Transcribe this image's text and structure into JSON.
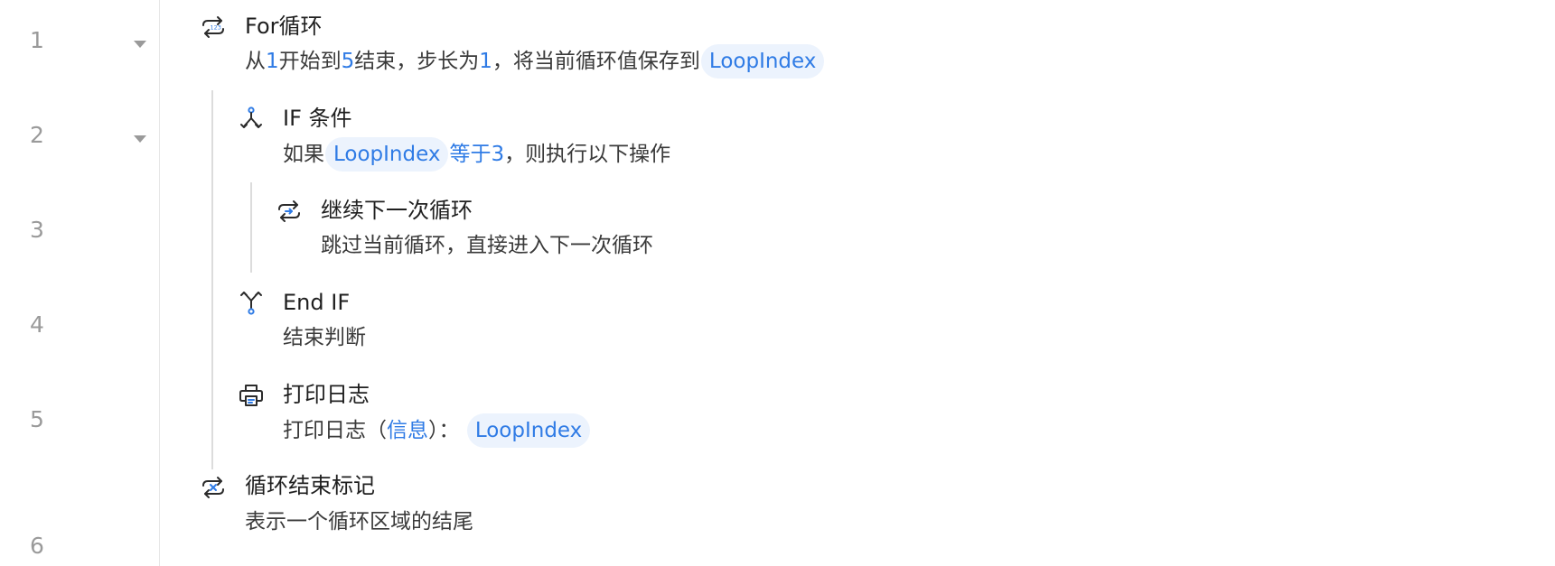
{
  "line_numbers": [
    "1",
    "2",
    "3",
    "4",
    "5",
    "6"
  ],
  "steps": {
    "for_loop": {
      "title": "For循环",
      "desc_from": "从",
      "start": "1",
      "desc_begin_to": "开始到",
      "end": "5",
      "desc_end_step": "结束，步长为",
      "step": "1",
      "desc_save_to": "，将当前循环值保存到",
      "var": "LoopIndex"
    },
    "if_condition": {
      "title": "IF 条件",
      "desc_if": "如果",
      "var": "LoopIndex",
      "op": "等于3",
      "desc_then": "，则执行以下操作"
    },
    "continue_loop": {
      "title": "继续下一次循环",
      "desc": "跳过当前循环，直接进入下一次循环"
    },
    "end_if": {
      "title": "End IF",
      "desc": "结束判断"
    },
    "print_log": {
      "title": "打印日志",
      "desc_prefix": "打印日志（",
      "level": "信息",
      "desc_suffix": "）：",
      "var": "LoopIndex"
    },
    "loop_end": {
      "title": "循环结束标记",
      "desc": "表示一个循环区域的结尾"
    }
  },
  "colors": {
    "accent": "#2f7be5",
    "pill_bg": "#ecf3fd",
    "gutter_text": "#9a9a9a",
    "guide_line": "#dcdcdc"
  },
  "icons": {
    "for_loop": "loop-icon",
    "if_condition": "branch-split-icon",
    "continue_loop": "continue-loop-icon",
    "end_if": "branch-merge-icon",
    "print_log": "printer-icon",
    "loop_end": "loop-end-icon"
  }
}
